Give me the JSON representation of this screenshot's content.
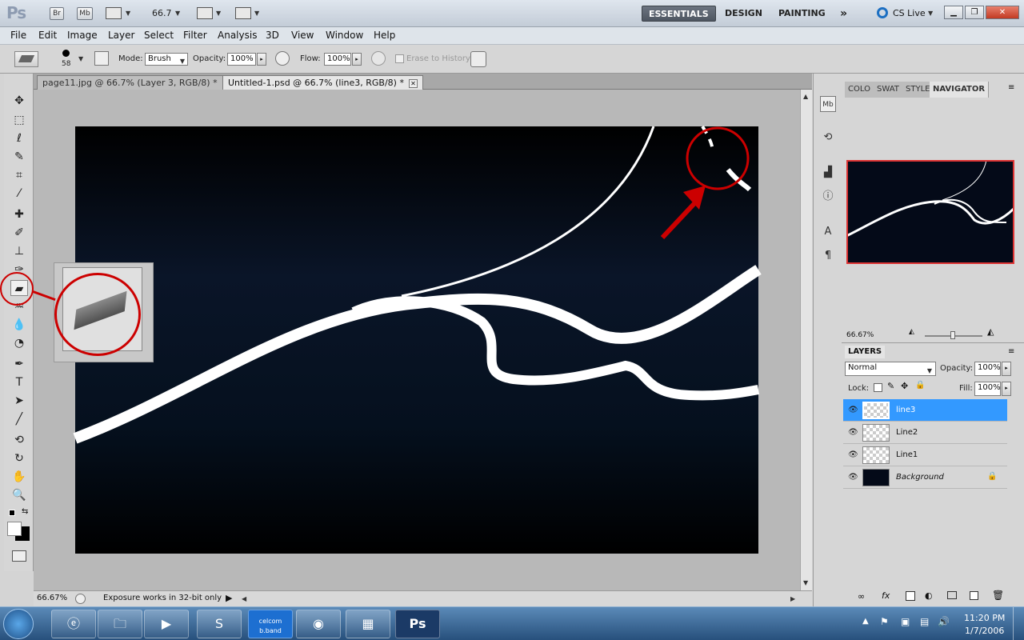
{
  "app": {
    "logo": "Ps",
    "bridge_label": "Br",
    "minibridge_label": "Mb",
    "zoom": "66.7",
    "workspaces": [
      "ESSENTIALS",
      "DESIGN",
      "PAINTING"
    ],
    "more_label": "»",
    "cs_live": "CS Live"
  },
  "menu": [
    "File",
    "Edit",
    "Image",
    "Layer",
    "Select",
    "Filter",
    "Analysis",
    "3D",
    "View",
    "Window",
    "Help"
  ],
  "options": {
    "brush_size": "58",
    "mode_label": "Mode:",
    "mode_value": "Brush",
    "opacity_label": "Opacity:",
    "opacity_value": "100%",
    "flow_label": "Flow:",
    "flow_value": "100%",
    "erase_history_label": "Erase to History"
  },
  "tabs": [
    {
      "label": "page11.jpg @ 66.7% (Layer 3, RGB/8) *"
    },
    {
      "label": "Untitled-1.psd @ 66.7% (line3, RGB/8) *"
    }
  ],
  "status": {
    "zoom": "66.67%",
    "message": "Exposure works in 32-bit only"
  },
  "panels": {
    "nav_tabs": [
      "COLO",
      "SWAT",
      "STYLE",
      "NAVIGATOR"
    ],
    "nav_zoom": "66.67%",
    "layers_title": "LAYERS",
    "blend_mode": "Normal",
    "opacity_label": "Opacity:",
    "opacity_value": "100%",
    "lock_label": "Lock:",
    "fill_label": "Fill:",
    "fill_value": "100%"
  },
  "layers": [
    {
      "name": "line3",
      "selected": true
    },
    {
      "name": "Line2",
      "selected": false
    },
    {
      "name": "Line1",
      "selected": false
    },
    {
      "name": "Background",
      "selected": false
    }
  ],
  "taskbar": {
    "time": "11:20 PM",
    "date": "1/7/2006",
    "celcom_label": "celcom b.band",
    "ps_label": "Ps"
  },
  "colors": {
    "canvas_dark": "#040a18",
    "selection_blue": "#3399ff",
    "annotation_red": "#cc0000"
  }
}
